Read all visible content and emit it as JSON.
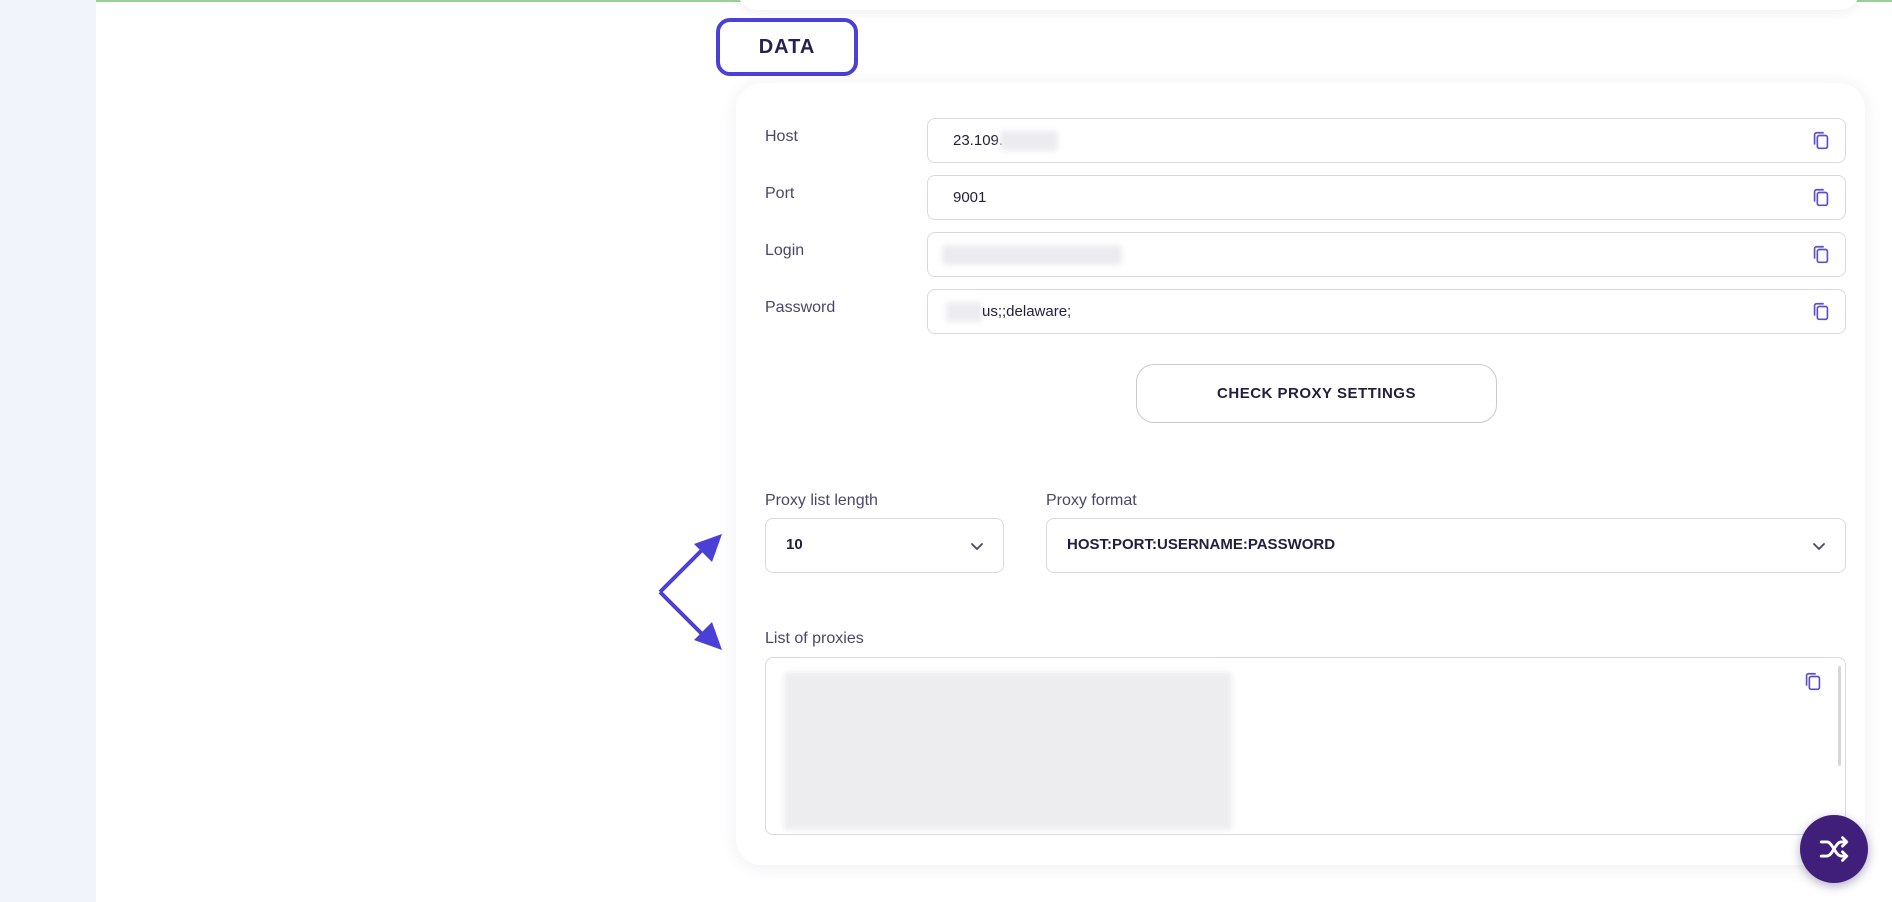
{
  "section_tab": "DATA",
  "fields": [
    {
      "label": "Host",
      "value": "23.109."
    },
    {
      "label": "Port",
      "value": "9001"
    },
    {
      "label": "Login",
      "value": ""
    },
    {
      "label": "Password",
      "value": "us;;delaware;"
    }
  ],
  "check_button": "CHECK PROXY SETTINGS",
  "proxy_list_length": {
    "label": "Proxy list length",
    "value": "10"
  },
  "proxy_format": {
    "label": "Proxy format",
    "value": "HOST:PORT:USERNAME:PASSWORD"
  },
  "proxy_list": {
    "label": "List of proxies",
    "value": ""
  },
  "colors": {
    "accent": "#4b40d6",
    "fab": "#3f1f7a",
    "rail": "#f1f4fb"
  },
  "icons": [
    "copy-icon",
    "chevron-down-icon",
    "shuffle-icon",
    "arrow-icon"
  ]
}
